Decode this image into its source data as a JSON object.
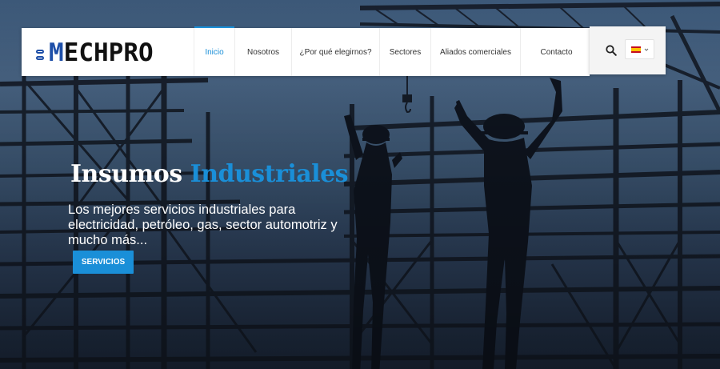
{
  "brand": {
    "logo_m": "M",
    "logo_rest": "ECHPRO",
    "color": "#1e4fa8"
  },
  "nav": {
    "items": [
      {
        "label": "Inicio",
        "active": true
      },
      {
        "label": "Nosotros"
      },
      {
        "label": "¿Por qué elegirnos?"
      },
      {
        "label": "Sectores"
      },
      {
        "label": "Aliados comerciales"
      },
      {
        "label": "Contacto"
      }
    ],
    "accent": "#1a8fd8"
  },
  "tools": {
    "search_icon": "search-icon",
    "language_flag": "spain-flag-icon"
  },
  "hero": {
    "title_part1": "Insumos",
    "title_part2": "Industriales",
    "subtitle": "Los mejores servicios industriales para electricidad, petróleo, gas, sector automotriz y mucho más...",
    "cta_label": "SERVICIOS",
    "background": "silhouettes-of-workers-on-steel-frame"
  }
}
